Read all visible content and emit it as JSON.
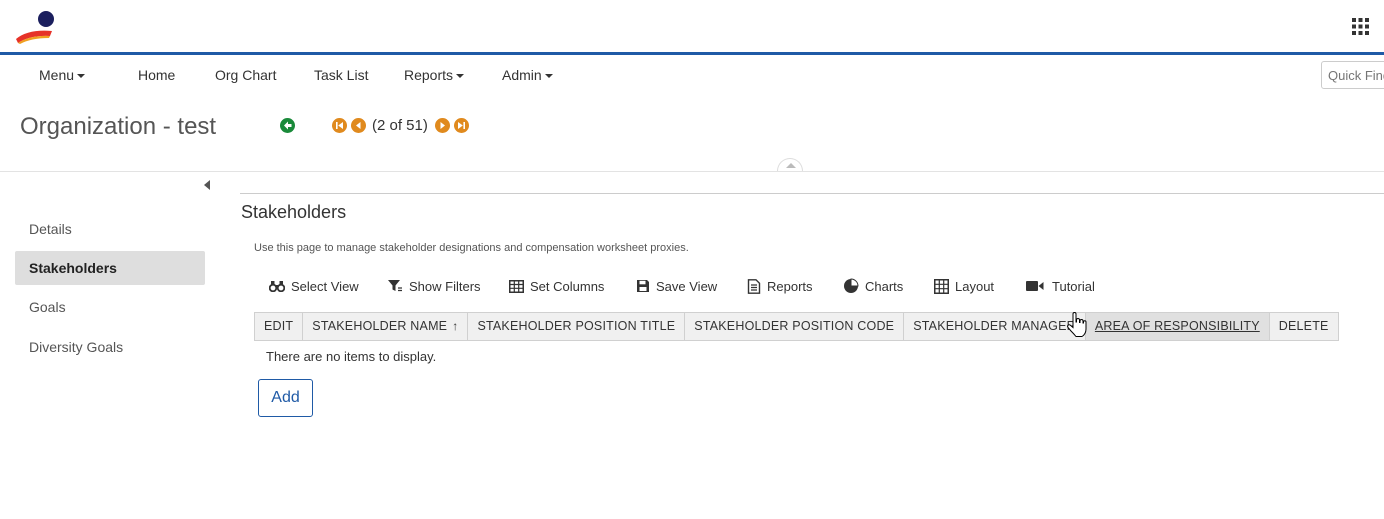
{
  "app": {
    "logo_icon": "company-logo",
    "apps_icon": "apps-grid-icon",
    "accent_color": "#1f5aa6"
  },
  "nav": {
    "items": [
      {
        "label": "Menu",
        "dropdown": true
      },
      {
        "label": "Home",
        "dropdown": false
      },
      {
        "label": "Org Chart",
        "dropdown": false
      },
      {
        "label": "Task List",
        "dropdown": false
      },
      {
        "label": "Reports",
        "dropdown": true
      },
      {
        "label": "Admin",
        "dropdown": true
      }
    ],
    "quick_find_placeholder": "Quick Find"
  },
  "header": {
    "title": "Organization - test",
    "pager_text": "(2 of 51)",
    "pager_color": "#e08a1e",
    "back_color": "#1a8a3a"
  },
  "sidebar": {
    "items": [
      {
        "label": "Details",
        "active": false
      },
      {
        "label": "Stakeholders",
        "active": true
      },
      {
        "label": "Goals",
        "active": false
      },
      {
        "label": "Diversity Goals",
        "active": false
      }
    ]
  },
  "main": {
    "section_title": "Stakeholders",
    "description": "Use this page to manage stakeholder designations and compensation worksheet proxies.",
    "toolbar": [
      {
        "label": "Select View",
        "icon": "binoculars-icon"
      },
      {
        "label": "Show Filters",
        "icon": "filter-icon"
      },
      {
        "label": "Set Columns",
        "icon": "columns-icon"
      },
      {
        "label": "Save View",
        "icon": "save-icon"
      },
      {
        "label": "Reports",
        "icon": "document-icon"
      },
      {
        "label": "Charts",
        "icon": "pie-chart-icon"
      },
      {
        "label": "Layout",
        "icon": "layout-grid-icon"
      },
      {
        "label": "Tutorial",
        "icon": "video-camera-icon"
      }
    ],
    "columns": [
      {
        "label": "EDIT"
      },
      {
        "label": "STAKEHOLDER NAME",
        "sort": "↑"
      },
      {
        "label": "STAKEHOLDER POSITION TITLE"
      },
      {
        "label": "STAKEHOLDER POSITION CODE"
      },
      {
        "label": "STAKEHOLDER MANAGER"
      },
      {
        "label": "AREA OF RESPONSIBILITY",
        "hover": true
      },
      {
        "label": "DELETE"
      }
    ],
    "empty_message": "There are no items to display.",
    "add_label": "Add"
  }
}
